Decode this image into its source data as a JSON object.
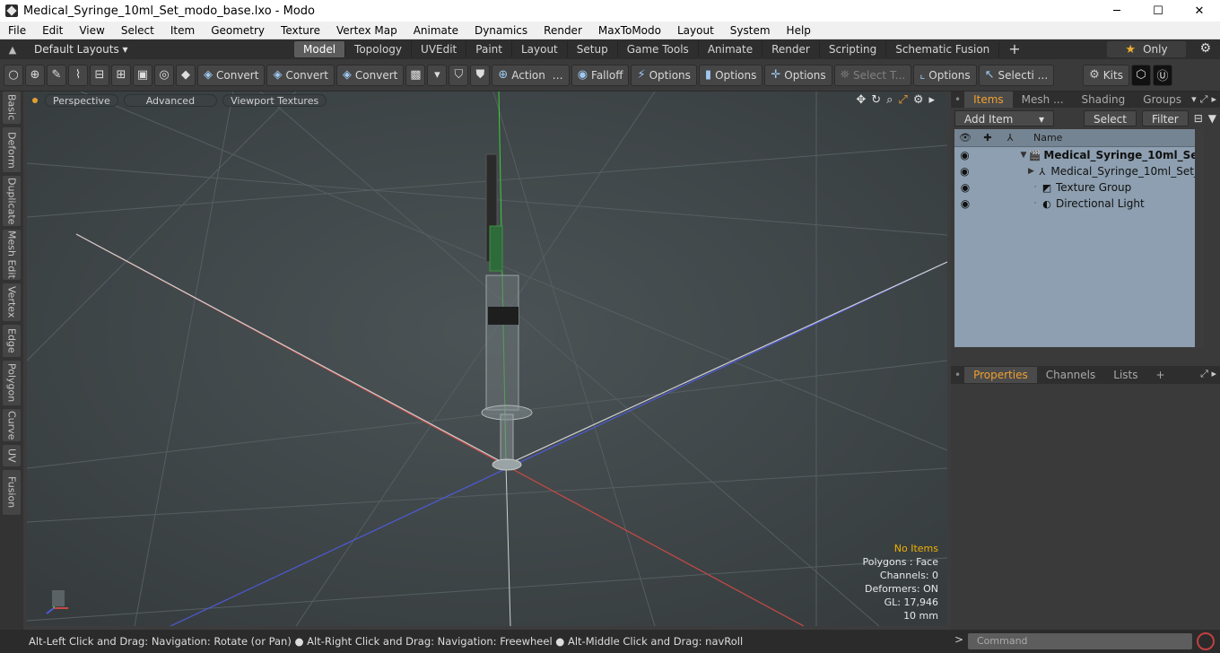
{
  "window": {
    "title": "Medical_Syringe_10ml_Set_modo_base.lxo - Modo",
    "minimize": "─",
    "maximize": "☐",
    "close": "✕"
  },
  "menu": [
    "File",
    "Edit",
    "View",
    "Select",
    "Item",
    "Geometry",
    "Texture",
    "Vertex Map",
    "Animate",
    "Dynamics",
    "Render",
    "MaxToModo",
    "Layout",
    "System",
    "Help"
  ],
  "layout": {
    "default_layouts": "Default Layouts ▾",
    "tabs": [
      "Model",
      "Topology",
      "UVEdit",
      "Paint",
      "Layout",
      "Setup",
      "Game Tools",
      "Animate",
      "Render",
      "Scripting",
      "Schematic Fusion"
    ],
    "active_tab": "Model",
    "plus": "+",
    "only": "Only"
  },
  "toolbar": {
    "convert1": "Convert",
    "convert2": "Convert",
    "convert3": "Convert",
    "action": "Action",
    "falloff": "Falloff",
    "options1": "Options",
    "options2": "Options",
    "options3": "Options",
    "options4": "Options",
    "select_t": "Select T...",
    "selecti": "Selecti ...",
    "kits": "Kits"
  },
  "left_tabs": [
    "Basic",
    "Deform",
    "Duplicate",
    "Mesh Edit",
    "Vertex",
    "Edge",
    "Polygon",
    "Curve",
    "UV",
    "Fusion"
  ],
  "viewport": {
    "perspective": "Perspective",
    "advanced": "Advanced",
    "viewport_textures": "Viewport Textures",
    "info": {
      "no_items": "No Items",
      "polygons": "Polygons : Face",
      "channels": "Channels: 0",
      "deformers": "Deformers: ON",
      "gl": "GL: 17,946",
      "units": "10 mm"
    }
  },
  "items_panel": {
    "tabs": [
      "Items",
      "Mesh ...",
      "Shading",
      "Groups"
    ],
    "active_tab": "Items",
    "add_item": "Add Item",
    "select": "Select",
    "filter": "Filter",
    "col_name": "Name",
    "rows": [
      {
        "name": "Medical_Syringe_10ml_Se..."
      },
      {
        "name": "Medical_Syringe_10ml_Set_ ..."
      },
      {
        "name": "Texture Group"
      },
      {
        "name": "Directional Light"
      }
    ]
  },
  "properties_panel": {
    "tabs": [
      "Properties",
      "Channels",
      "Lists"
    ],
    "plus": "+"
  },
  "status": {
    "hint": "Alt-Left Click and Drag: Navigation: Rotate (or Pan) ● Alt-Right Click and Drag: Navigation: Freewheel ● Alt-Middle Click and Drag: navRoll",
    "command_placeholder": "Command"
  }
}
